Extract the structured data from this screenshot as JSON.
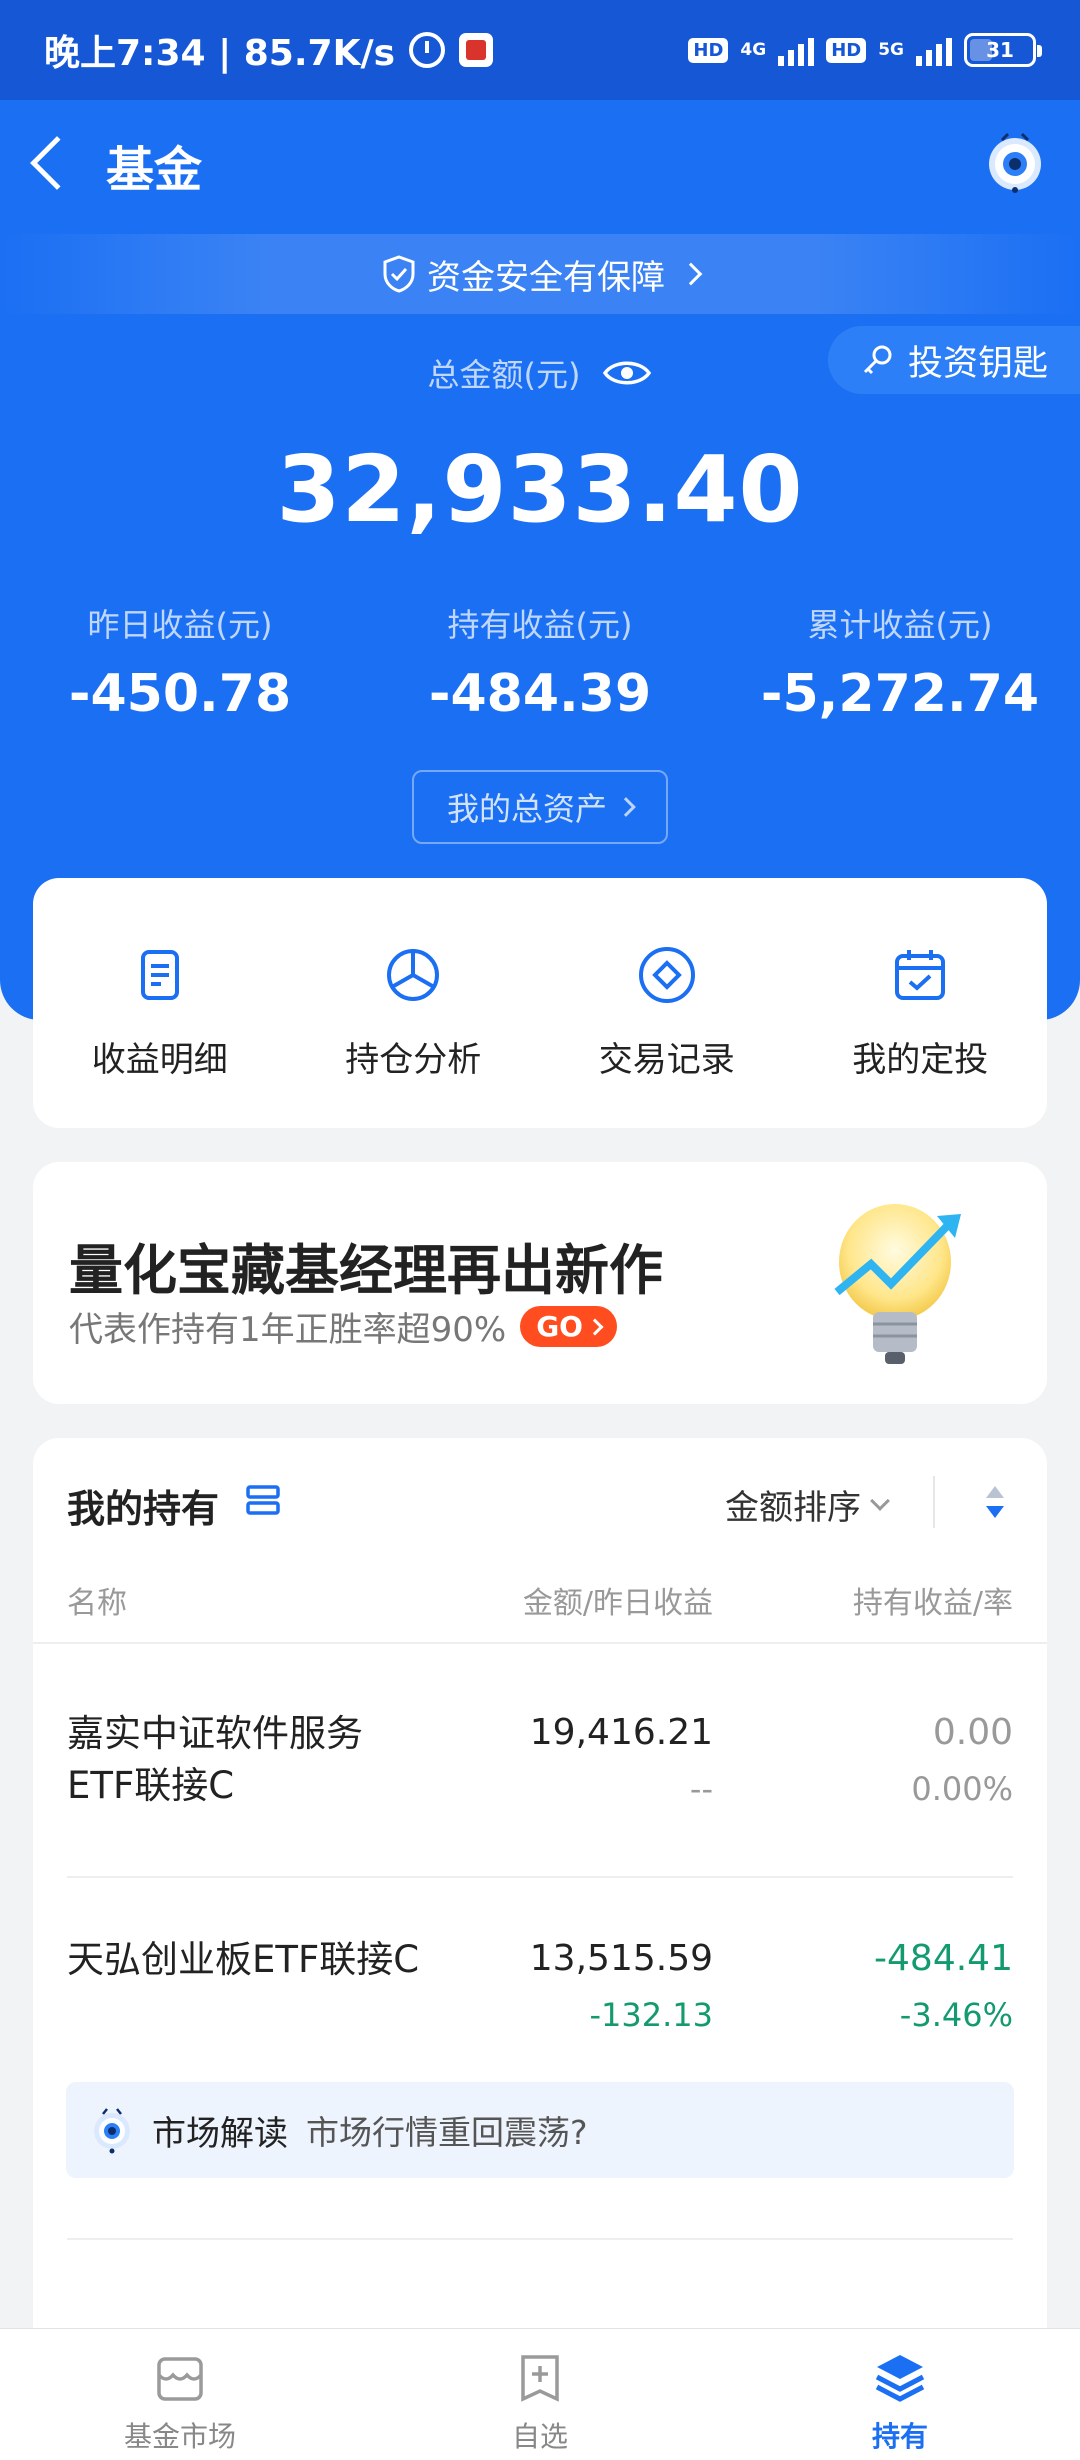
{
  "status_bar": {
    "time_speed": "晚上7:34 | 85.7K/s",
    "net1": "4G",
    "net2": "5G",
    "hd": "HD",
    "battery": "31"
  },
  "header": {
    "title": "基金"
  },
  "security_banner": {
    "text": "资金安全有保障"
  },
  "invest_key": {
    "label": "投资钥匙"
  },
  "summary": {
    "total_label": "总金额(元)",
    "total_amount": "32,933.40",
    "yesterday_label": "昨日收益(元)",
    "yesterday_value": "-450.78",
    "holding_label": "持有收益(元)",
    "holding_value": "-484.39",
    "cumulative_label": "累计收益(元)",
    "cumulative_value": "-5,272.74",
    "assets_button": "我的总资产"
  },
  "quick_menu": [
    {
      "label": "收益明细",
      "icon": "document-icon"
    },
    {
      "label": "持仓分析",
      "icon": "pie-chart-icon"
    },
    {
      "label": "交易记录",
      "icon": "compass-icon"
    },
    {
      "label": "我的定投",
      "icon": "calendar-check-icon"
    }
  ],
  "promo": {
    "title": "量化宝藏基经理再出新作",
    "subtitle": "代表作持有1年正胜率超90%",
    "go": "GO"
  },
  "holdings": {
    "title": "我的持有",
    "sort_label": "金额排序",
    "col_name": "名称",
    "col_amount": "金额/昨日收益",
    "col_hold": "持有收益/率",
    "rows": [
      {
        "name_line1": "嘉实中证软件服务",
        "name_line2": "ETF联接C",
        "amount": "19,416.21",
        "yesterday": "--",
        "hold_profit": "0.00",
        "hold_rate": "0.00%"
      },
      {
        "name_line1": "天弘创业板ETF联接C",
        "name_line2": "",
        "amount": "13,515.59",
        "yesterday": "-132.13",
        "hold_profit": "-484.41",
        "hold_rate": "-3.46%"
      }
    ],
    "insight": {
      "tag": "市场解读",
      "text": "市场行情重回震荡?"
    }
  },
  "colors": {
    "brand_blue": "#1b6ff3",
    "loss_green": "#149a6f",
    "gain_red": "#e8413a",
    "promo_orange": "#ff4d1f"
  },
  "tabbar": [
    {
      "label": "基金市场",
      "icon": "store-icon",
      "active": false
    },
    {
      "label": "自选",
      "icon": "bookmark-plus-icon",
      "active": false
    },
    {
      "label": "持有",
      "icon": "layers-icon",
      "active": true
    }
  ]
}
